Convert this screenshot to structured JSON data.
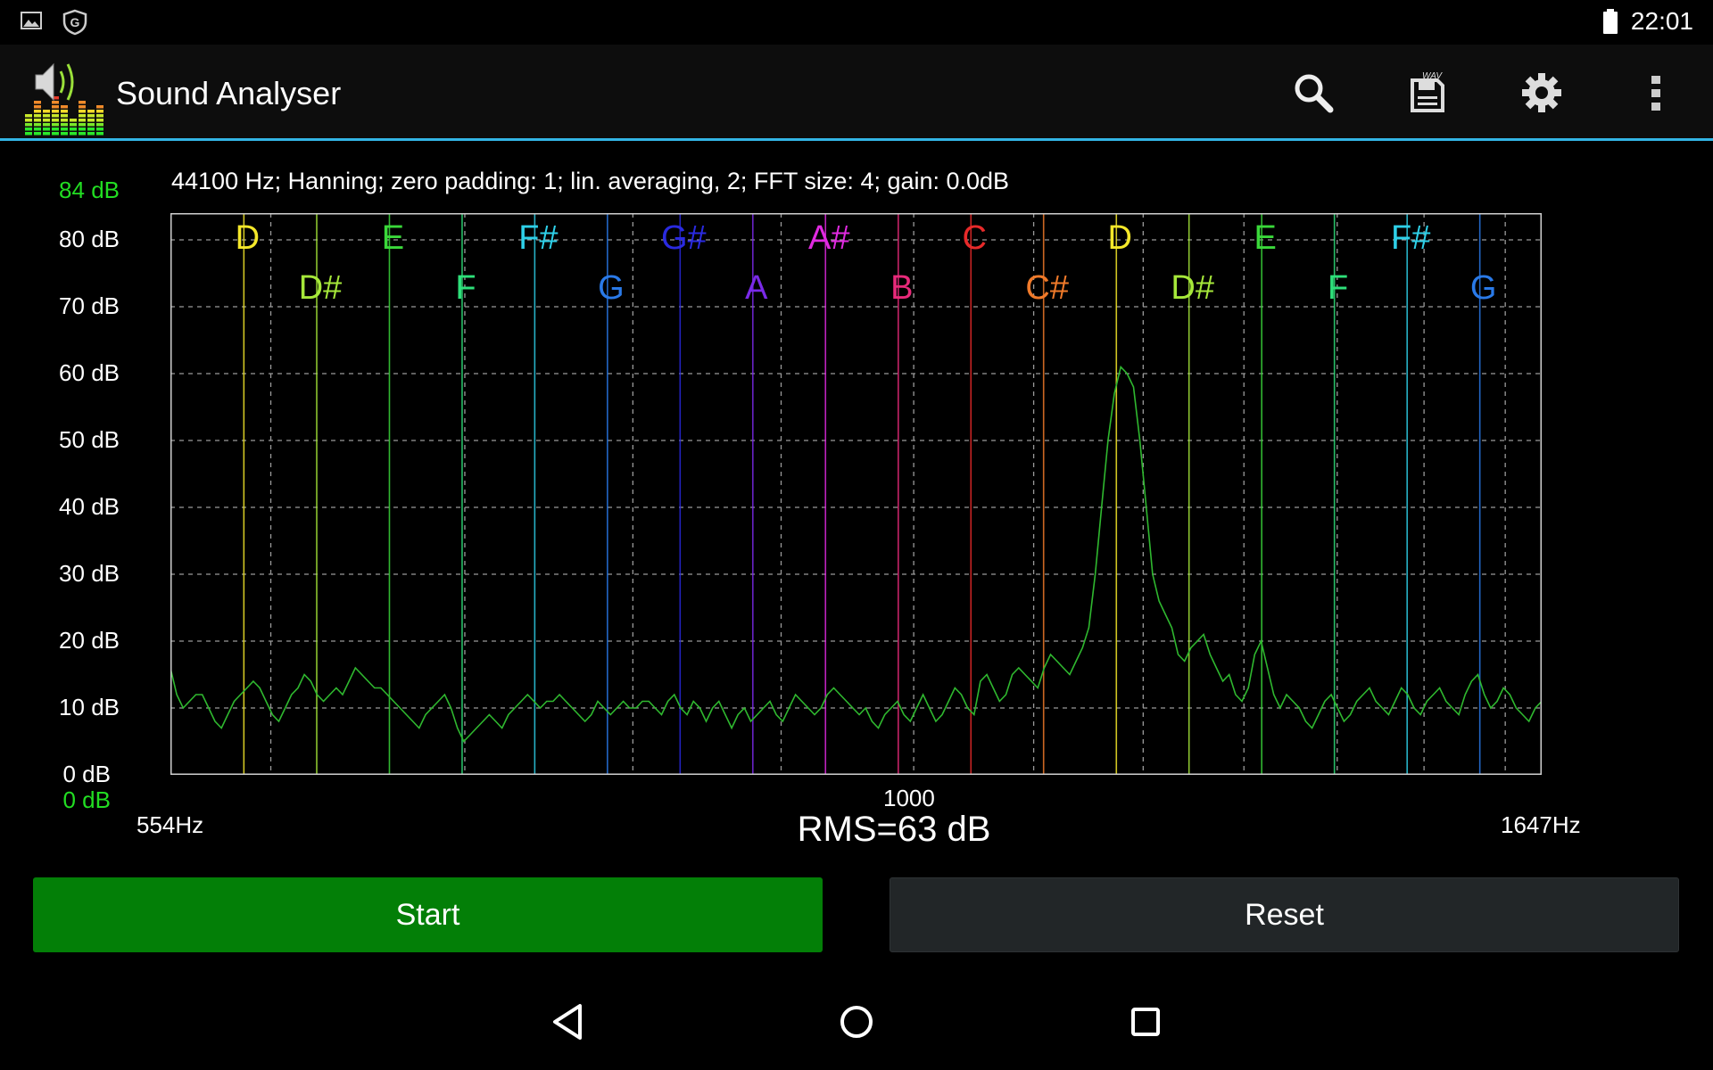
{
  "status_bar": {
    "time": "22:01",
    "left_icons": [
      "image-notification-icon",
      "shield-g-icon"
    ],
    "right_icons": [
      "battery-icon"
    ]
  },
  "action_bar": {
    "title": "Sound Analyser",
    "icons": [
      "search-icon",
      "save-wav-icon",
      "settings-gear-icon",
      "overflow-menu-icon"
    ],
    "save_badge": "WAV",
    "accent_color": "#33b5e5"
  },
  "spectrum": {
    "info_line": "44100 Hz; Hanning; zero padding: 1; lin. averaging, 2; FFT size: 4; gain: 0.0dB",
    "y_top_label": "84 dB",
    "y_bottom_label": "0 dB",
    "x_min_label": "554Hz",
    "x_max_label": "1647Hz",
    "x_mid_label": "1000",
    "rms_text": "RMS=63 dB"
  },
  "chart_data": {
    "type": "line",
    "x_scale": "log",
    "xlim": [
      554,
      1647
    ],
    "ylim": [
      0,
      84
    ],
    "ylabel_ticks": [
      "80 dB",
      "70 dB",
      "60 dB",
      "50 dB",
      "40 dB",
      "30 dB",
      "20 dB",
      "10 dB",
      "0 dB"
    ],
    "y_tick_values": [
      80,
      70,
      60,
      50,
      40,
      30,
      20,
      10,
      0
    ],
    "grid": true,
    "line_color": "#2fb82f",
    "notes": [
      {
        "name": "D",
        "freq": 587.3,
        "row": 1,
        "color": "#f5e82a"
      },
      {
        "name": "D#",
        "freq": 622.3,
        "row": 2,
        "color": "#a6e83a"
      },
      {
        "name": "E",
        "freq": 659.3,
        "row": 1,
        "color": "#3ad83a"
      },
      {
        "name": "F",
        "freq": 698.5,
        "row": 2,
        "color": "#2ee07a"
      },
      {
        "name": "F#",
        "freq": 740.0,
        "row": 1,
        "color": "#2ed0e8"
      },
      {
        "name": "G",
        "freq": 784.0,
        "row": 2,
        "color": "#2a7ae8"
      },
      {
        "name": "G#",
        "freq": 830.6,
        "row": 1,
        "color": "#2a2ae0"
      },
      {
        "name": "A",
        "freq": 880.0,
        "row": 2,
        "color": "#7a2ae8"
      },
      {
        "name": "A#",
        "freq": 932.3,
        "row": 1,
        "color": "#e02ae0"
      },
      {
        "name": "B",
        "freq": 987.8,
        "row": 2,
        "color": "#e82a7a"
      },
      {
        "name": "C",
        "freq": 1046.5,
        "row": 1,
        "color": "#e82a2a"
      },
      {
        "name": "C#",
        "freq": 1108.7,
        "row": 2,
        "color": "#f07a2a"
      },
      {
        "name": "D",
        "freq": 1174.7,
        "row": 1,
        "color": "#f5e82a"
      },
      {
        "name": "D#",
        "freq": 1244.5,
        "row": 2,
        "color": "#a6e83a"
      },
      {
        "name": "E",
        "freq": 1318.5,
        "row": 1,
        "color": "#3ad83a"
      },
      {
        "name": "F",
        "freq": 1396.9,
        "row": 2,
        "color": "#2ee07a"
      },
      {
        "name": "F#",
        "freq": 1480.0,
        "row": 1,
        "color": "#2ed0e8"
      },
      {
        "name": "G",
        "freq": 1568.0,
        "row": 2,
        "color": "#2a7ae8"
      }
    ],
    "series": [
      {
        "values_db": [
          16,
          12,
          10,
          11,
          12,
          12,
          10,
          8,
          7,
          9,
          11,
          12,
          13,
          14,
          13,
          11,
          9,
          8,
          10,
          12,
          13,
          15,
          14,
          12,
          11,
          12,
          13,
          12,
          14,
          16,
          15,
          14,
          13,
          13,
          12,
          11,
          10,
          9,
          8,
          7,
          9,
          10,
          11,
          12,
          10,
          7,
          5,
          6,
          7,
          8,
          9,
          8,
          7,
          9,
          10,
          11,
          12,
          11,
          10,
          11,
          11,
          12,
          11,
          10,
          9,
          8,
          9,
          11,
          10,
          9,
          10,
          11,
          10,
          10,
          11,
          11,
          10,
          9,
          11,
          12,
          10,
          9,
          11,
          10,
          8,
          10,
          11,
          9,
          7,
          9,
          10,
          8,
          9,
          10,
          11,
          9,
          8,
          10,
          12,
          11,
          10,
          9,
          10,
          12,
          13,
          12,
          11,
          10,
          9,
          10,
          8,
          7,
          9,
          10,
          11,
          9,
          8,
          10,
          12,
          10,
          8,
          9,
          11,
          13,
          12,
          10,
          9,
          14,
          15,
          13,
          11,
          12,
          15,
          16,
          15,
          14,
          13,
          16,
          18,
          17,
          16,
          15,
          17,
          19,
          22,
          30,
          40,
          50,
          57,
          61,
          60,
          58,
          50,
          40,
          30,
          26,
          24,
          22,
          18,
          17,
          19,
          20,
          21,
          18,
          16,
          14,
          15,
          12,
          11,
          13,
          18,
          20,
          16,
          12,
          10,
          12,
          11,
          10,
          8,
          7,
          9,
          11,
          12,
          10,
          8,
          9,
          11,
          12,
          13,
          11,
          10,
          9,
          11,
          13,
          12,
          10,
          9,
          11,
          12,
          13,
          11,
          10,
          9,
          12,
          14,
          15,
          12,
          10,
          11,
          13,
          12,
          10,
          9,
          8,
          10,
          11
        ]
      }
    ]
  },
  "buttons": {
    "start": "Start",
    "reset": "Reset"
  },
  "nav_bar": {
    "icons": [
      "back-icon",
      "home-icon",
      "recents-icon"
    ]
  }
}
